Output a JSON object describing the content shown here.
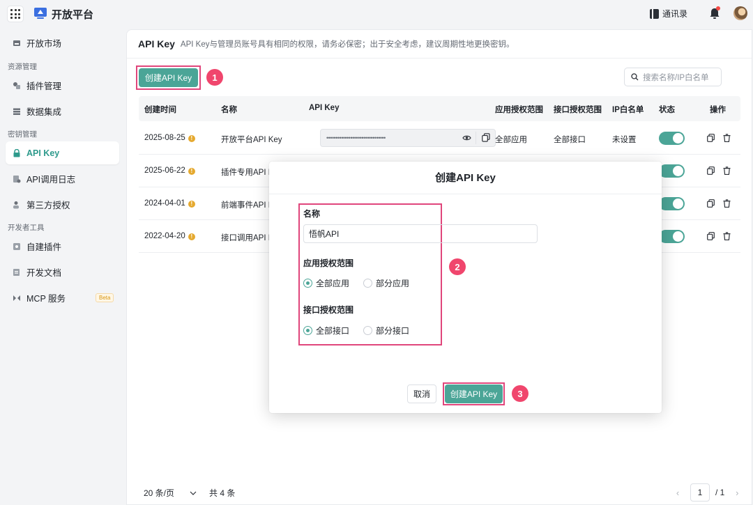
{
  "app": {
    "title": "开放平台"
  },
  "topbar": {
    "contacts_label": "通讯录",
    "apps_icon": "grid-icon",
    "notification_icon": "bell-icon"
  },
  "sidebar": {
    "items": [
      {
        "label": "开放市场",
        "icon": "store-icon"
      },
      {
        "group": "资源管理"
      },
      {
        "label": "插件管理",
        "icon": "plugin-icon"
      },
      {
        "label": "数据集成",
        "icon": "database-icon"
      },
      {
        "group": "密钥管理"
      },
      {
        "label": "API Key",
        "icon": "key-icon",
        "active": true
      },
      {
        "label": "API调用日志",
        "icon": "log-icon"
      },
      {
        "label": "第三方授权",
        "icon": "user-auth-icon"
      },
      {
        "group": "开发者工具"
      },
      {
        "label": "自建插件",
        "icon": "custom-plugin-icon"
      },
      {
        "label": "开发文档",
        "icon": "doc-icon"
      },
      {
        "label": "MCP 服务",
        "icon": "mcp-icon",
        "badge": "Beta"
      }
    ]
  },
  "page": {
    "title": "API Key",
    "description": "API Key与管理员账号具有相同的权限，请务必保密；出于安全考虑，建议周期性地更换密钥。",
    "create_button": "创建API Key",
    "search_placeholder": "搜索名称/IP白名单",
    "step_badges": [
      "1",
      "2",
      "3"
    ]
  },
  "table": {
    "columns": [
      "创建时间",
      "名称",
      "API Key",
      "应用授权范围",
      "接口授权范围",
      "IP白名单",
      "状态",
      "操作"
    ],
    "rows": [
      {
        "created": "2025-08-25",
        "name": "开放平台API Key",
        "key": "••••••••••••••••••••••••••••••••",
        "app_scope": "全部应用",
        "api_scope": "全部接口",
        "ip_whitelist": "未设置",
        "enabled": true
      },
      {
        "created": "2025-06-22",
        "name": "插件专用API K",
        "enabled": true
      },
      {
        "created": "2024-04-01",
        "name": "前端事件API K",
        "enabled": true
      },
      {
        "created": "2022-04-20",
        "name": "接口调用API K",
        "enabled": true
      }
    ]
  },
  "pagination": {
    "page_size": "20 条/页",
    "total": "共 4 条",
    "current": "1",
    "of_total": "/ 1"
  },
  "modal": {
    "title": "创建API Key",
    "name_label": "名称",
    "name_value": "悟帆API",
    "app_scope_label": "应用授权范围",
    "app_scope_options": [
      {
        "label": "全部应用",
        "checked": true
      },
      {
        "label": "部分应用",
        "checked": false
      }
    ],
    "api_scope_label": "接口授权范围",
    "api_scope_options": [
      {
        "label": "全部接口",
        "checked": true
      },
      {
        "label": "部分接口",
        "checked": false
      }
    ],
    "cancel": "取消",
    "confirm": "创建API Key"
  },
  "colors": {
    "accent": "#4ba597",
    "highlight": "#e0457b",
    "badge": "#f0466d",
    "warning": "#e5a92f"
  }
}
